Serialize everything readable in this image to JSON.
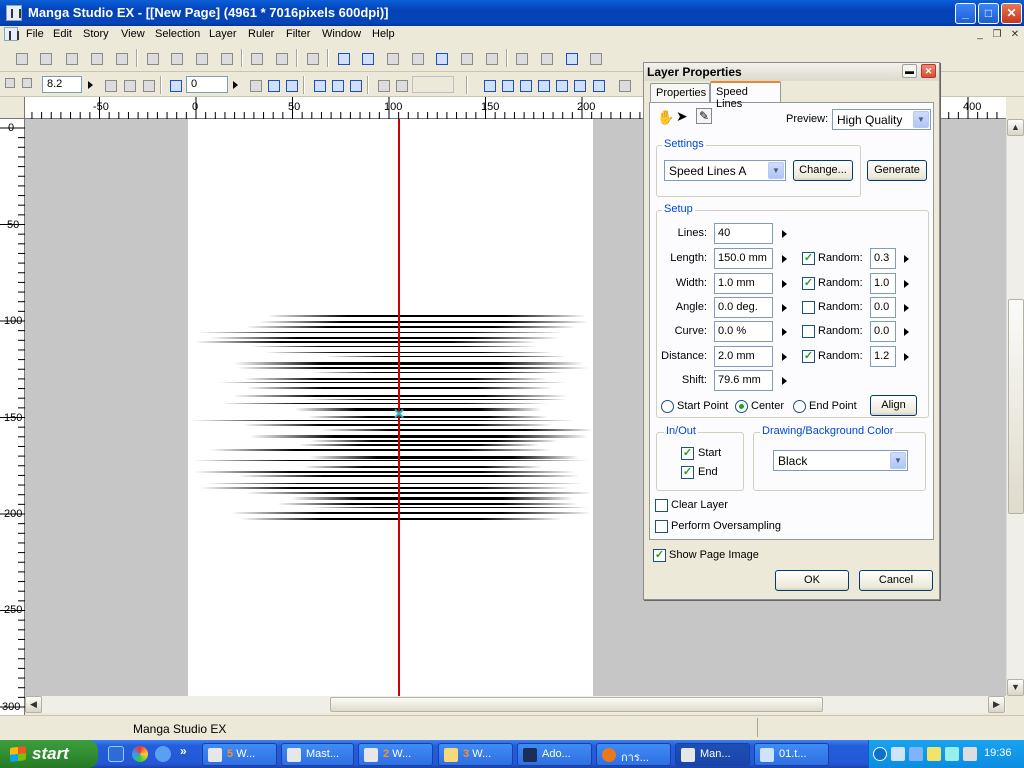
{
  "window": {
    "title": "Manga Studio EX - [[New Page] (4961 * 7016pixels 600dpi)]",
    "min": "_",
    "max": "□",
    "close": "✕"
  },
  "menu": [
    "File",
    "Edit",
    "Story",
    "View",
    "Selection",
    "Layer",
    "Ruler",
    "Filter",
    "Window",
    "Help"
  ],
  "mdi": {
    "min": "_",
    "restore": "❐",
    "close": "✕"
  },
  "toolbar2": {
    "zoom_value": "8.2",
    "rotate_value": "0"
  },
  "ruler": {
    "h_labels": [
      "-50",
      "0",
      "50",
      "100",
      "150",
      "200",
      "400"
    ],
    "v_labels": [
      "0",
      "50",
      "100",
      "150",
      "200",
      "250",
      "300"
    ]
  },
  "status": {
    "text": "Manga Studio EX"
  },
  "taskbar": {
    "start": "start",
    "chevron": "»",
    "tasks": [
      {
        "count": "5",
        "label": "W..."
      },
      {
        "count": "",
        "label": "Mast..."
      },
      {
        "count": "2",
        "label": "W..."
      },
      {
        "count": "3",
        "label": "W..."
      },
      {
        "count": "",
        "label": "Ado..."
      },
      {
        "count": "",
        "label": "การ..."
      },
      {
        "count": "",
        "label": "Man..."
      },
      {
        "count": "",
        "label": "01.t..."
      }
    ],
    "clock": "19:36"
  },
  "dialog": {
    "title": "Layer Properties",
    "tabs": [
      "Properties",
      "Speed Lines"
    ],
    "preview_label": "Preview:",
    "preview_value": "High Quality",
    "settings_group": "Settings",
    "settings_value": "Speed Lines A",
    "change_button": "Change...",
    "generate_button": "Generate",
    "setup_group": "Setup",
    "rows": [
      {
        "label": "Lines:",
        "value": "40"
      },
      {
        "label": "Length:",
        "value": "150.0 mm",
        "random": "0.3",
        "checked": true
      },
      {
        "label": "Width:",
        "value": "1.0 mm",
        "random": "1.0",
        "checked": true
      },
      {
        "label": "Angle:",
        "value": "0.0 deg.",
        "random": "0.0",
        "checked": false
      },
      {
        "label": "Curve:",
        "value": "0.0 %",
        "random": "0.0",
        "checked": false
      },
      {
        "label": "Distance:",
        "value": "2.0 mm",
        "random": "1.2",
        "checked": true
      },
      {
        "label": "Shift:",
        "value": "79.6 mm"
      }
    ],
    "random_label": "Random:",
    "align_options": [
      "Start Point",
      "Center",
      "End Point"
    ],
    "align_selected": "Center",
    "align_button": "Align",
    "inout_group": "In/Out",
    "inout_start": "Start",
    "inout_end": "End",
    "color_group": "Drawing/Background Color",
    "color_value": "Black",
    "clear_layer": "Clear Layer",
    "oversampling": "Perform Oversampling",
    "show_page_image": "Show Page Image",
    "ok": "OK",
    "cancel": "Cancel"
  }
}
